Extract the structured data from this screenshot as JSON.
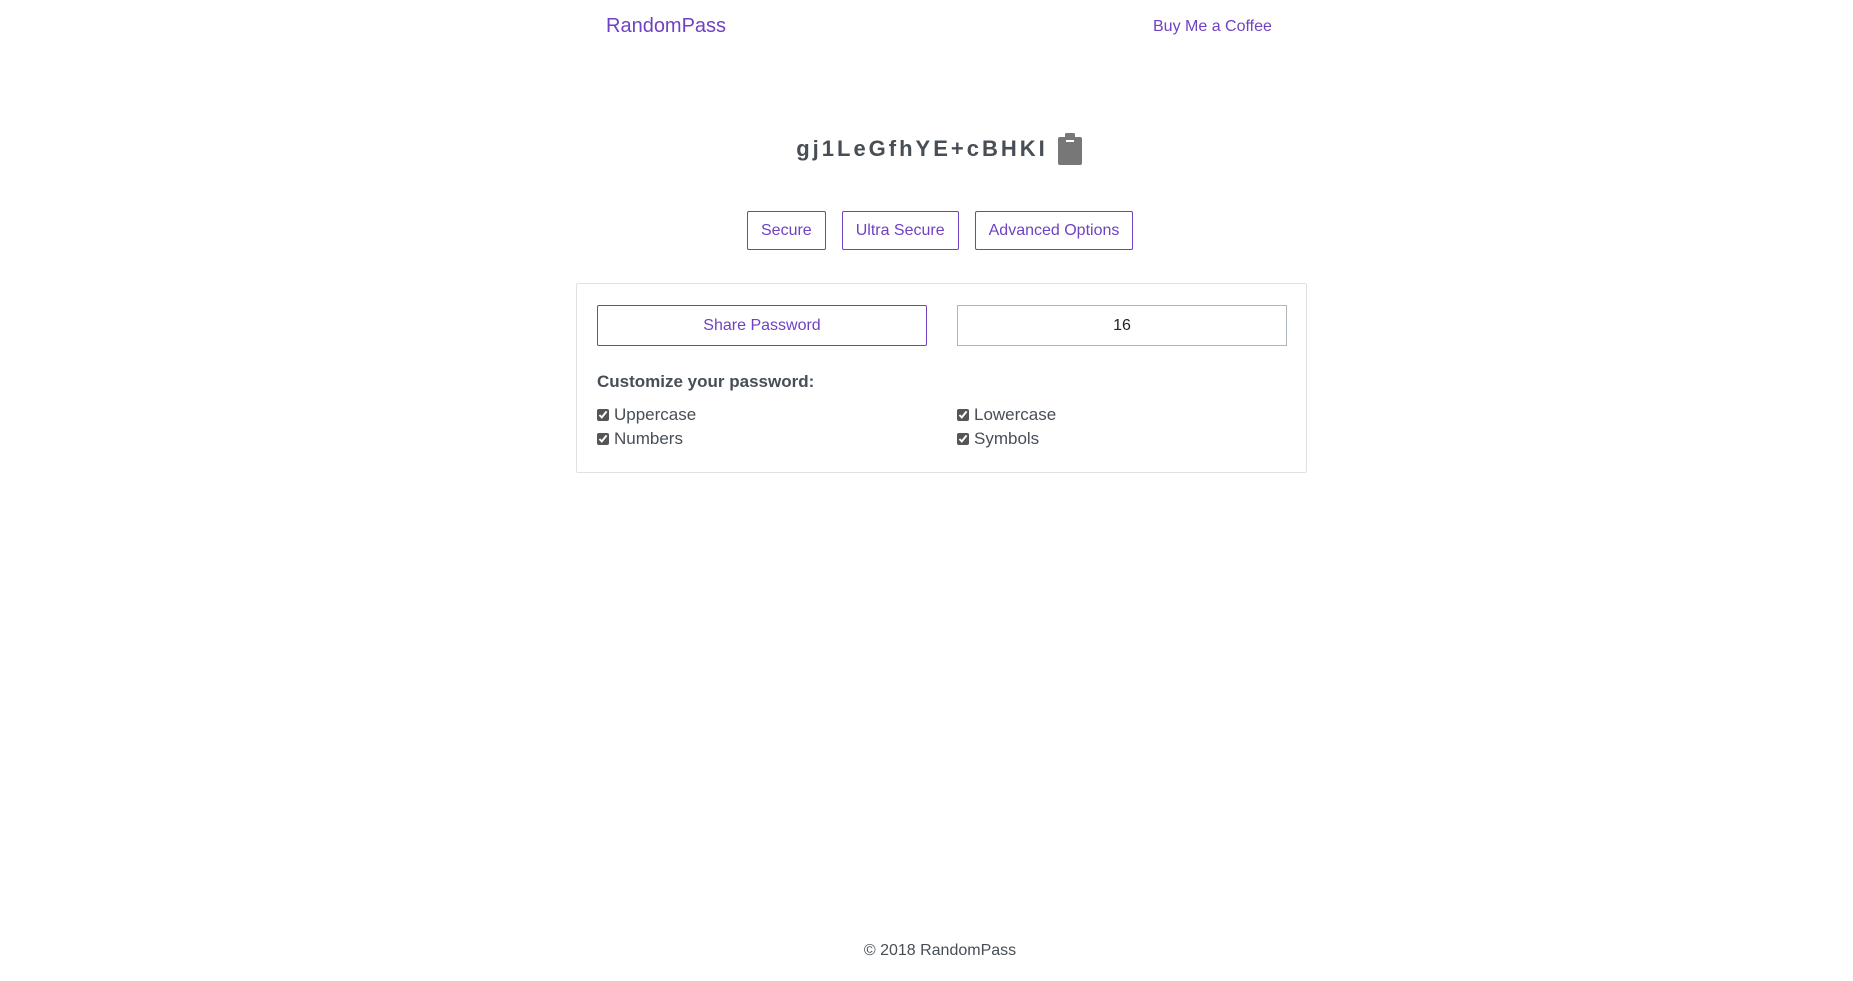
{
  "nav": {
    "brand": "RandomPass",
    "coffee_link": "Buy Me a Coffee"
  },
  "password": {
    "value": "gj1LeGfhYE+cBHKI",
    "copy_icon": "clipboard-icon"
  },
  "presets": {
    "secure": "Secure",
    "ultra_secure": "Ultra Secure",
    "advanced": "Advanced Options"
  },
  "options": {
    "share_label": "Share Password",
    "length_value": "16",
    "customize_title": "Customize your password:",
    "uppercase": "Uppercase",
    "lowercase": "Lowercase",
    "numbers": "Numbers",
    "symbols": "Symbols",
    "uppercase_checked": true,
    "lowercase_checked": true,
    "numbers_checked": true,
    "symbols_checked": true
  },
  "footer": {
    "copyright": "© 2018 RandomPass"
  },
  "colors": {
    "accent": "#6f42c1",
    "text": "#474e56",
    "border": "#dee2e6"
  }
}
